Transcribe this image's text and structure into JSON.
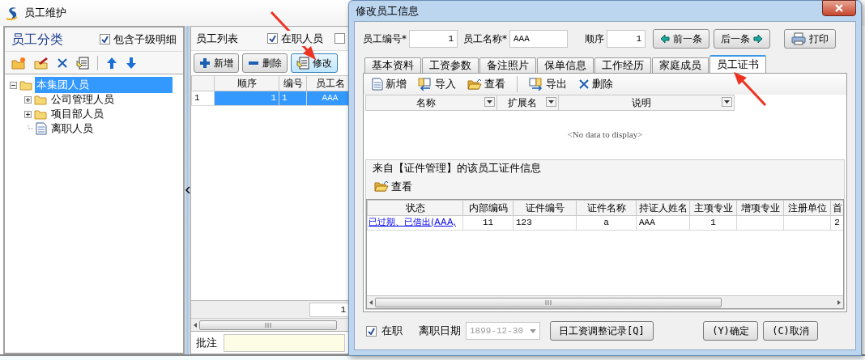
{
  "window": {
    "title": "员工维护"
  },
  "category_panel": {
    "title": "员工分类",
    "include_children": {
      "label": "包含子级明细",
      "checked": true
    },
    "tree": [
      {
        "label": "本集团人员",
        "kind": "folder",
        "expanded": true,
        "selected": true,
        "children": [
          {
            "label": "公司管理人员",
            "kind": "folder",
            "expanded": false,
            "selected": false
          },
          {
            "label": "项目部人员",
            "kind": "folder",
            "expanded": false,
            "selected": false
          },
          {
            "label": "离职人员",
            "kind": "document",
            "selected": false
          }
        ]
      }
    ]
  },
  "list_panel": {
    "title": "员工列表",
    "filters": [
      {
        "label": "在职人员",
        "checked": true
      },
      {
        "checked": false
      }
    ],
    "toolbar": [
      {
        "label": "新增",
        "highlighted": false
      },
      {
        "label": "删除",
        "highlighted": false
      },
      {
        "label": "修改",
        "highlighted": true
      }
    ],
    "table": {
      "columns": [
        "顺序",
        "编号",
        "员工名"
      ],
      "rows": [
        {
          "row_number": "1",
          "cells": [
            "1",
            "1",
            "AAA"
          ],
          "selected": true
        }
      ]
    },
    "footer_total": "1",
    "note": {
      "label": "批注"
    }
  },
  "dialog": {
    "title": "修改员工信息",
    "fields": [
      {
        "label": "员工编号*",
        "value": "1"
      },
      {
        "label": "员工名称*",
        "value": "AAA"
      },
      {
        "label": "顺序",
        "value": "1"
      }
    ],
    "nav_buttons": [
      "前一条",
      "后一条",
      "打印"
    ],
    "tabs": [
      {
        "label": "基本资料",
        "selected": false
      },
      {
        "label": "工资参数",
        "selected": false
      },
      {
        "label": "备注照片",
        "selected": false
      },
      {
        "label": "保单信息",
        "selected": false
      },
      {
        "label": "工作经历",
        "selected": false
      },
      {
        "label": "家庭成员",
        "selected": false
      },
      {
        "label": "员工证书",
        "selected": true
      }
    ],
    "toolbar": [
      "新增",
      "导入",
      "查看",
      "导出",
      "删除"
    ],
    "certificate_table": {
      "columns": [
        "名称",
        "扩展名",
        "说明"
      ],
      "empty_text": "<No data to display>"
    },
    "linked_section": {
      "title": "来自【证件管理】的该员工证件信息",
      "toolbar": [
        "查看"
      ],
      "columns": [
        "状态",
        "内部编码",
        "证件编号",
        "证件名称",
        "持证人姓名",
        "主项专业",
        "增项专业",
        "注册单位",
        "首"
      ],
      "rows": [
        {
          "cells": [
            "已过期、已借出(AAA,",
            "11",
            "123",
            "a",
            "AAA",
            "1",
            null,
            null,
            "2"
          ]
        }
      ]
    },
    "active": {
      "label": "在职",
      "checked": true
    },
    "leave_date": {
      "label": "离职日期",
      "value": "1899-12-30",
      "disabled": true
    },
    "buttons": [
      "日工资调整记录[Q]",
      "(Y)确定",
      "(C)取消"
    ]
  }
}
